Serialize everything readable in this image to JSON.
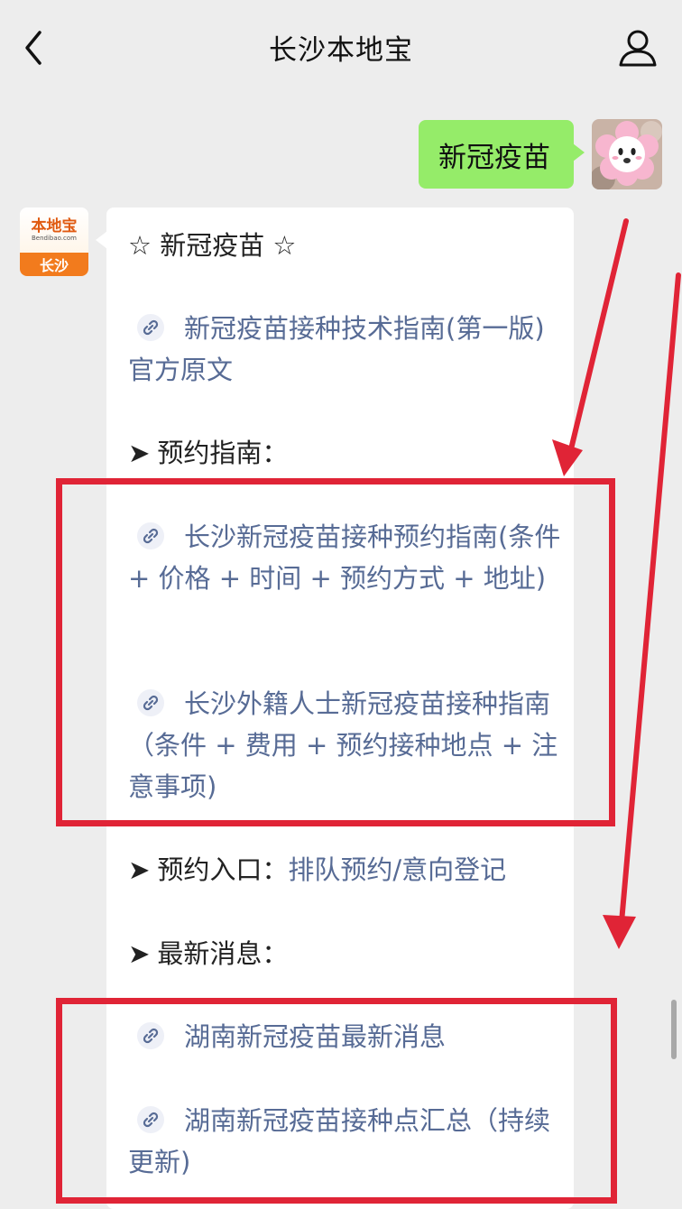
{
  "header": {
    "title": "长沙本地宝",
    "back_icon": "chevron-left-icon",
    "profile_icon": "person-icon"
  },
  "messages": {
    "outgoing": {
      "text": "新冠疫苗",
      "bubble_color": "#95ec69"
    },
    "incoming": {
      "avatar": {
        "logo_text": "本地宝",
        "logo_sub": "Bendibao.com",
        "city": "长沙"
      },
      "heading": "☆ 新冠疫苗 ☆",
      "link_tech": "新冠疫苗接种技术指南(第一版)官方原文",
      "section_guide": "预约指南：",
      "link_guide": "长沙新冠疫苗接种预约指南(条件 + 价格 + 时间 + 预约方式 + 地址)",
      "link_foreign": "长沙外籍人士新冠疫苗接种指南（条件 + 费用 + 预约接种地点 + 注意事项)",
      "entry_label": "预约入口：",
      "entry_link1": "排队预约",
      "entry_sep": "/",
      "entry_link2": "意向登记",
      "section_news": "最新消息：",
      "link_news": "湖南新冠疫苗最新消息",
      "link_sites": "湖南新冠疫苗接种点汇总（持续更新)"
    }
  },
  "icons": {
    "link": "link-icon",
    "bullet": "➤",
    "annotation_color": "#e02436",
    "link_color": "#576b95"
  }
}
